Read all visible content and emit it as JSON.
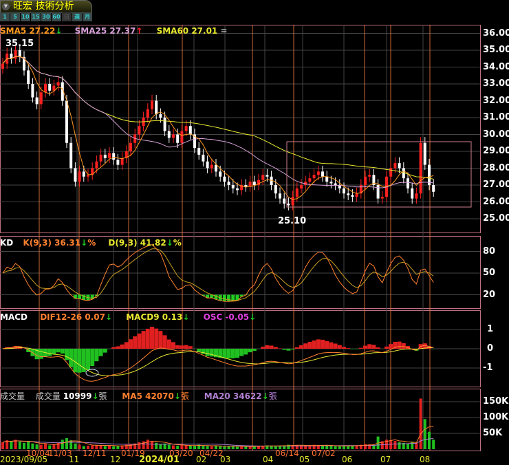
{
  "header": {
    "title": "旺宏 技術分析",
    "periods": [
      "1",
      "5",
      "10",
      "15",
      "30",
      "60",
      "日",
      "週",
      "月"
    ],
    "selected_period": "日"
  },
  "legends": {
    "price": {
      "sma5": "SMA5 27.22",
      "sma5_dir": "↓",
      "sma25": "SMA25 27.37",
      "sma25_dir": "↑",
      "sma60": "SMA60 27.01",
      "sma60_dir": "="
    },
    "kd": {
      "label": "KD",
      "k": "K(9,3) 36.31",
      "k_dir": "↓",
      "d": "D(9,3) 41.82",
      "d_dir": "↓",
      "pct": "%"
    },
    "macd": {
      "label": "MACD",
      "dif": "DIF12-26 0.07",
      "dif_dir": "↓",
      "macd9": "MACD9 0.13",
      "macd9_dir": "↓",
      "osc": "OSC -0.05",
      "osc_dir": "↓"
    },
    "volume": {
      "label": "成交量",
      "vol_name": "成交量",
      "vol": "10999",
      "vol_dir": "↓",
      "unit": "張",
      "ma5": "MA5 42070",
      "ma5_dir": "↓",
      "ma20": "MA20 34622",
      "ma20_dir": "↓"
    }
  },
  "annotations": {
    "high": "35.15",
    "low": "25.10"
  },
  "axes": {
    "price": [
      "36.00",
      "35.00",
      "34.00",
      "33.00",
      "32.00",
      "31.00",
      "30.00",
      "29.00",
      "28.00",
      "27.00",
      "26.00",
      "25.00"
    ],
    "kd": [
      "80",
      "50",
      "20"
    ],
    "macd": [
      "1",
      "0",
      "-1"
    ],
    "volume": [
      "150K",
      "100K",
      "50K"
    ],
    "dates_top": [
      "10/04",
      "11/03",
      "12/11",
      "01/19",
      "03/20",
      "04/22",
      "06/14",
      "07/02"
    ],
    "dates_bottom": [
      "2023/09/05",
      "11",
      "12",
      "2024/01",
      "02",
      "03",
      "04",
      "05",
      "06",
      "07",
      "08"
    ]
  },
  "colors": {
    "up": "#ff2020",
    "down": "#ffffff",
    "sma5": "#ff9a20",
    "sma25": "#d8a0d8",
    "sma60": "#e8e830",
    "grid": "#444",
    "marker": "#ff8040"
  },
  "chart_data": {
    "type": "candlestick",
    "closes": [
      34.2,
      34.8,
      34.5,
      35.0,
      34.6,
      33.8,
      33.0,
      32.2,
      31.8,
      32.5,
      33.0,
      32.6,
      32.9,
      33.1,
      32.0,
      29.5,
      28.0,
      27.2,
      27.8,
      27.5,
      27.6,
      28.0,
      28.4,
      28.8,
      28.6,
      28.9,
      28.5,
      28.2,
      28.6,
      29.0,
      29.5,
      30.0,
      30.5,
      31.0,
      31.5,
      32.0,
      31.2,
      31.0,
      30.2,
      29.8,
      30.0,
      29.5,
      30.2,
      30.5,
      30.0,
      29.2,
      28.8,
      28.4,
      28.0,
      28.2,
      27.8,
      27.5,
      27.2,
      27.0,
      26.8,
      26.7,
      27.0,
      26.9,
      27.2,
      27.0,
      27.3,
      27.6,
      27.5,
      27.0,
      26.5,
      26.2,
      25.9,
      25.8,
      26.3,
      26.8,
      27.0,
      27.2,
      27.4,
      27.6,
      27.8,
      27.5,
      27.2,
      27.1,
      27.0,
      26.8,
      26.5,
      26.4,
      26.3,
      26.5,
      27.0,
      27.5,
      27.6,
      27.0,
      26.2,
      26.3,
      27.5,
      28.0,
      28.3,
      28.0,
      27.4,
      26.8,
      26.2,
      26.5,
      29.5,
      28.2,
      27.0,
      26.6
    ],
    "volumes": [
      22,
      28,
      25,
      30,
      24,
      20,
      26,
      18,
      15,
      14,
      17,
      12,
      16,
      20,
      30,
      35,
      28,
      18,
      14,
      10,
      11,
      12,
      14,
      13,
      10,
      11,
      9,
      10,
      12,
      14,
      16,
      18,
      22,
      25,
      30,
      26,
      20,
      15,
      18,
      14,
      12,
      11,
      13,
      12,
      11,
      10,
      14,
      12,
      10,
      9,
      11,
      10,
      8,
      9,
      10,
      8,
      9,
      8,
      9,
      10,
      9,
      11,
      12,
      10,
      9,
      11,
      12,
      14,
      13,
      12,
      11,
      10,
      12,
      14,
      13,
      12,
      11,
      10,
      9,
      10,
      12,
      11,
      10,
      12,
      14,
      16,
      15,
      13,
      40,
      25,
      30,
      28,
      26,
      22,
      20,
      18,
      24,
      20,
      160,
      95,
      55,
      30
    ],
    "ylim": [
      24.5,
      36.5
    ]
  }
}
